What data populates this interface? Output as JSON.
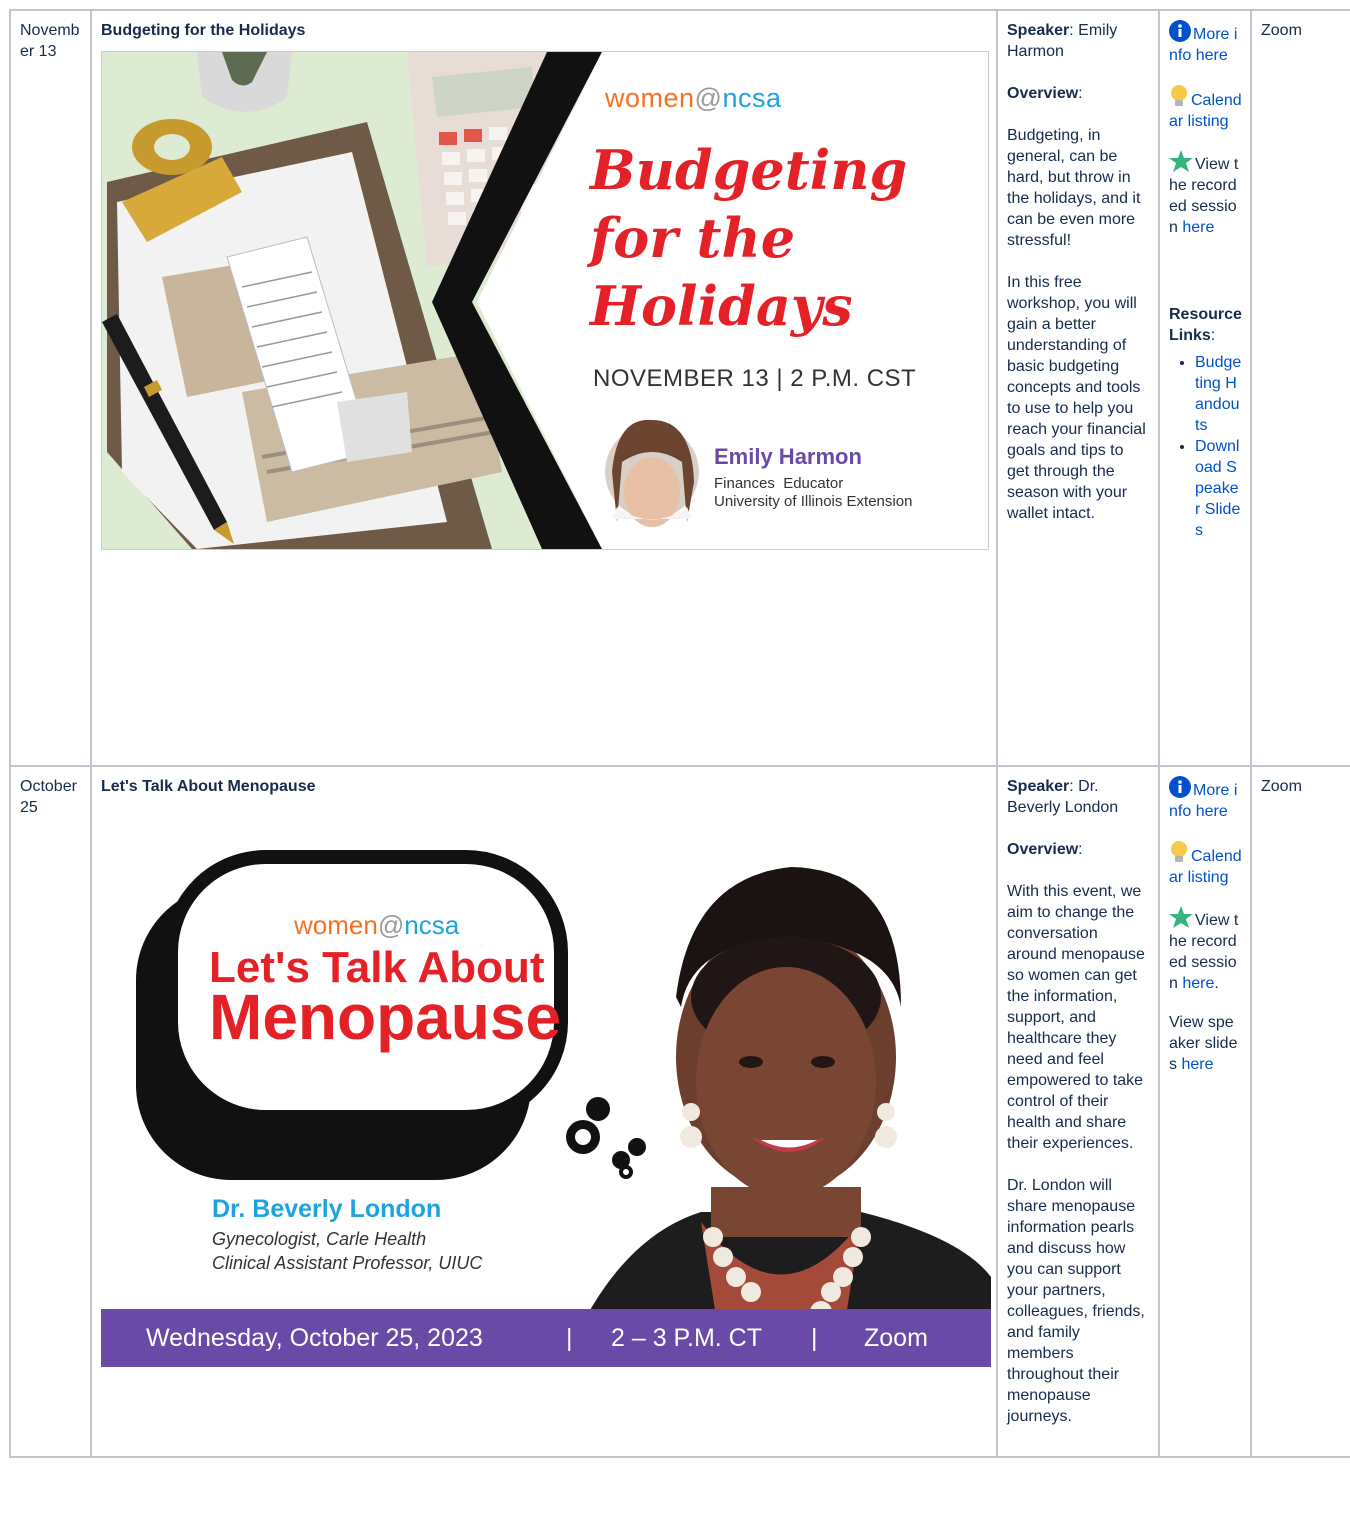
{
  "events": [
    {
      "date": "November 13",
      "title": "Budgeting for the Holidays",
      "banner": {
        "brand_prefix": "women",
        "brand_at": "@",
        "brand_suffix": "ncsa",
        "headline_lines": [
          "Budgeting",
          "for the",
          "Holidays"
        ],
        "date_time": "NOVEMBER 13 | 2 P.M. CST",
        "speaker_name": "Emily Harmon",
        "speaker_role": "Finances  Educator",
        "speaker_org": "University of Illinois Extension"
      },
      "speaker_label": "Speaker",
      "speaker": ": Emily Harmon",
      "overview_label": "Overview",
      "overview_paragraphs": [
        "Budgeting, in general, can be hard, but throw in the holidays, and it can be even more stressful!",
        "In this free workshop, you will gain a better understanding of basic budgeting concepts and tools to use to help you reach your financial goals and tips to get through the season with your wallet intact."
      ],
      "links": {
        "more_info": "More info here",
        "calendar": "Calendar listing",
        "recorded_a": "View",
        "recorded_b": "the recorded session",
        "recorded_c": "here",
        "resources_label": "Resource Links",
        "resources": [
          "Budgeting Handouts",
          "Download Speaker Slides"
        ]
      },
      "location": "Zoom"
    },
    {
      "date": "October 25",
      "title": "Let's Talk About Menopause",
      "banner": {
        "brand_prefix": "women",
        "brand_at": "@",
        "brand_suffix": "ncsa",
        "headline_1": "Let's Talk About",
        "headline_2": "Menopause",
        "speaker_name": "Dr. Beverly London",
        "speaker_role": "Gynecologist, Carle Health",
        "speaker_role2": "Clinical Assistant Professor, UIUC",
        "footer_date": "Wednesday, October 25, 2023",
        "footer_sep": "|",
        "footer_time": "2 – 3 P.M. CT",
        "footer_place": "Zoom"
      },
      "speaker_label": "Speaker",
      "speaker": ": Dr. Beverly London",
      "overview_label": "Overview",
      "overview_paragraphs": [
        "With this event, we aim to change the conversation around menopause so women can get the information, support, and healthcare they need and feel empowered to take control of their health and share their experiences.",
        "Dr. London will share menopause information pearls and discuss how you can support your partners, colleagues, friends, and family members throughout their menopause journeys."
      ],
      "links": {
        "more_info": "More info here",
        "calendar": "Calendar listing",
        "recorded_a": "View",
        "recorded_b": "the recorded session",
        "recorded_c": "here",
        "recorded_d": ".",
        "slides_text": "View speaker slides",
        "slides_link": "here"
      },
      "location": "Zoom"
    }
  ],
  "icon_names": [
    "info-icon",
    "lightbulb-icon",
    "star-icon"
  ],
  "colors": {
    "link": "#0052cc",
    "brand_orange": "#f37321",
    "brand_blue": "#1fa3dc",
    "headline_red": "#e32127",
    "purple": "#6a4aa7"
  }
}
